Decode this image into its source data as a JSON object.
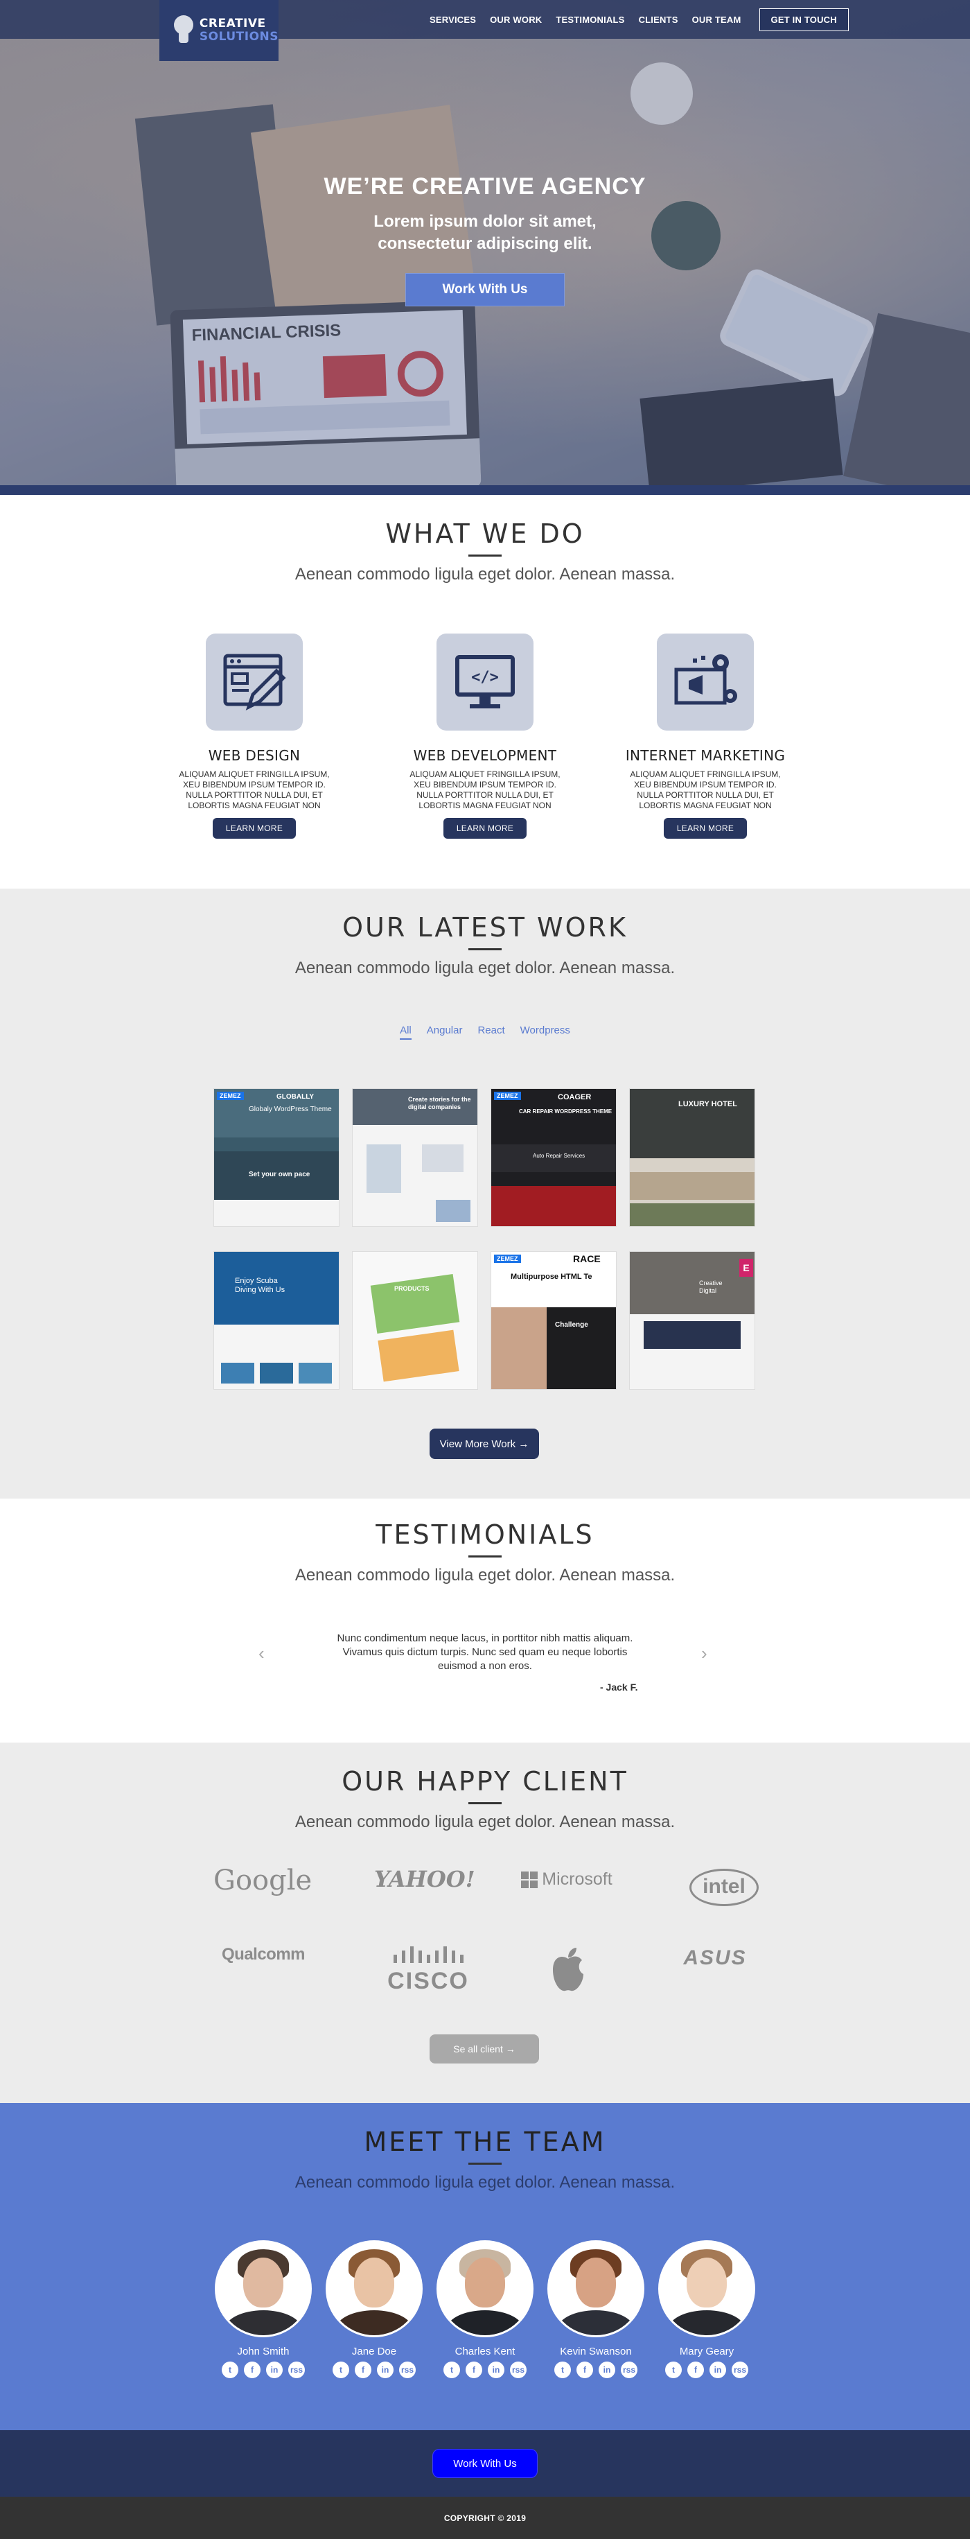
{
  "logo": {
    "line1": "CREATIVE",
    "line2": "SOLUTIONS"
  },
  "nav": {
    "items": [
      "SERVICES",
      "OUR WORK",
      "TESTIMONIALS",
      "CLIENTS",
      "OUR TEAM"
    ],
    "cta": "GET IN TOUCH"
  },
  "hero": {
    "headline": "WE’RE CREATIVE AGENCY",
    "sub1": "Lorem ipsum dolor sit amet,",
    "sub2": "consectetur adipiscing elit.",
    "button": "Work With Us",
    "laptop_title": "FINANCIAL CRISIS"
  },
  "services": {
    "title": "WHAT WE DO",
    "subtitle": "Aenean commodo ligula eget dolor. Aenean massa.",
    "items": [
      {
        "title": "WEB DESIGN",
        "desc": "ALIQUAM ALIQUET FRINGILLA IPSUM, XEU BIBENDUM IPSUM TEMPOR ID. NULLA PORTTITOR NULLA DUI, ET LOBORTIS MAGNA FEUGIAT NON",
        "icon": "web-design-icon",
        "button": "LEARN MORE"
      },
      {
        "title": "WEB DEVELOPMENT",
        "desc": "ALIQUAM ALIQUET FRINGILLA IPSUM, XEU BIBENDUM IPSUM TEMPOR ID. NULLA PORTTITOR NULLA DUI, ET LOBORTIS MAGNA FEUGIAT NON",
        "icon": "code-monitor-icon",
        "button": "LEARN MORE"
      },
      {
        "title": "INTERNET MARKETING",
        "desc": "ALIQUAM ALIQUET FRINGILLA IPSUM, XEU BIBENDUM IPSUM TEMPOR ID. NULLA PORTTITOR NULLA DUI, ET LOBORTIS MAGNA FEUGIAT NON",
        "icon": "megaphone-gear-icon",
        "button": "LEARN MORE"
      }
    ]
  },
  "work": {
    "title": "OUR LATEST WORK",
    "subtitle": "Aenean commodo ligula eget dolor. Aenean massa.",
    "filters": [
      "All",
      "Angular",
      "React",
      "Wordpress"
    ],
    "active_filter": "All",
    "thumbs": [
      {
        "label": "GLOBALLY",
        "sub": "Globaly WordPress Theme",
        "badge": "ZEMEZ",
        "caption": "Set your own pace"
      },
      {
        "label": "Create stories for the digital companies",
        "sub": "",
        "badge": "",
        "caption": ""
      },
      {
        "label": "COAGER",
        "sub": "CAR REPAIR WORDPRESS THEME",
        "badge": "ZEMEZ",
        "caption": "Auto Repair Services"
      },
      {
        "label": "LUXURY HOTEL",
        "sub": "",
        "badge": "",
        "caption": ""
      },
      {
        "label": "Enjoy Scuba Diving With Us",
        "sub": "",
        "badge": "",
        "caption": ""
      },
      {
        "label": "PRODUCTS",
        "sub": "",
        "badge": "",
        "caption": ""
      },
      {
        "label": "RACE",
        "sub": "Multipurpose HTML Te",
        "badge": "ZEMEZ",
        "caption": "Challenge"
      },
      {
        "label": "Creative Digital",
        "sub": "",
        "badge": "E",
        "caption": ""
      }
    ],
    "button": "View More Work →"
  },
  "testimonials": {
    "title": "TESTIMONIALS",
    "subtitle": "Aenean commodo ligula eget dolor. Aenean massa.",
    "quote": "Nunc condimentum neque lacus, in porttitor nibh mattis aliquam. Vivamus quis dictum turpis. Nunc sed quam eu neque lobortis euismod a non eros.",
    "author": "- Jack F.",
    "prev": "‹",
    "next": "›"
  },
  "clients": {
    "title": "OUR HAPPY CLIENT",
    "subtitle": "Aenean commodo ligula eget dolor. Aenean massa.",
    "logos": [
      "Google",
      "YAHOO!",
      "Microsoft",
      "intel",
      "Qualcomm",
      "CISCO",
      "apple-logo",
      "ASUS"
    ],
    "button": "Se all client  →"
  },
  "team": {
    "title": "MEET THE TEAM",
    "subtitle": "Aenean commodo ligula eget dolor. Aenean massa.",
    "members": [
      {
        "name": "John Smith",
        "skin": "#e0b9a0",
        "hair": "#4a3a30",
        "body": "#2e2e33"
      },
      {
        "name": "Jane Doe",
        "skin": "#e9c3a5",
        "hair": "#8a5a35",
        "body": "#3d2b22"
      },
      {
        "name": "Charles Kent",
        "skin": "#d9a889",
        "hair": "#c8b5a0",
        "body": "#1f2228"
      },
      {
        "name": "Kevin Swanson",
        "skin": "#d7a284",
        "hair": "#6d3d22",
        "body": "#2c2f38"
      },
      {
        "name": "Mary Geary",
        "skin": "#eecfb6",
        "hair": "#a57955",
        "body": "#26282e"
      }
    ],
    "socials": [
      "t",
      "f",
      "in",
      "rss"
    ]
  },
  "footer": {
    "button": "Work With Us",
    "copyright": "COPYRIGHT © 2019"
  },
  "colors": {
    "navy": "#27355e",
    "accent": "#5a7bd0",
    "grey_bg": "#ececec",
    "footer_dark": "#333333"
  }
}
